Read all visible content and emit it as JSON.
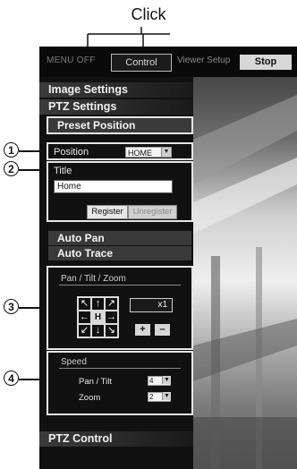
{
  "annotation": {
    "click_label": "Click"
  },
  "topbar": {
    "menu_off": "MENU  OFF",
    "control_tab": "Control",
    "viewer_setup": "Viewer Setup",
    "stop_button": "Stop"
  },
  "sidebar": {
    "image_settings": "Image Settings",
    "ptz_settings": "PTZ Settings",
    "preset_position": "Preset Position",
    "position_label": "Position",
    "position_value": "HOME",
    "title_label": "Title",
    "title_value": "Home",
    "register_button": "Register",
    "unregister_button": "Unregister",
    "auto_pan": "Auto Pan",
    "auto_trace": "Auto Trace",
    "ptz_group_title": "Pan / Tilt / Zoom",
    "zoom_display": "x1",
    "zoom_in": "+",
    "zoom_out": "–",
    "speed_title": "Speed",
    "pan_tilt_label": "Pan / Tilt",
    "pan_tilt_value": "4",
    "zoom_label": "Zoom",
    "zoom_value": "2",
    "ptz_control": "PTZ Control",
    "dir_buttons": [
      "↖",
      "↑",
      "↗",
      "←",
      "H",
      "→",
      "↙",
      "↓",
      "↘"
    ]
  },
  "callouts": [
    "1",
    "2",
    "3",
    "4"
  ],
  "colors": {
    "frame_bg": "#151515",
    "highlight_border": "#e6e6e6",
    "stop_bg": "#d7d7d7"
  }
}
